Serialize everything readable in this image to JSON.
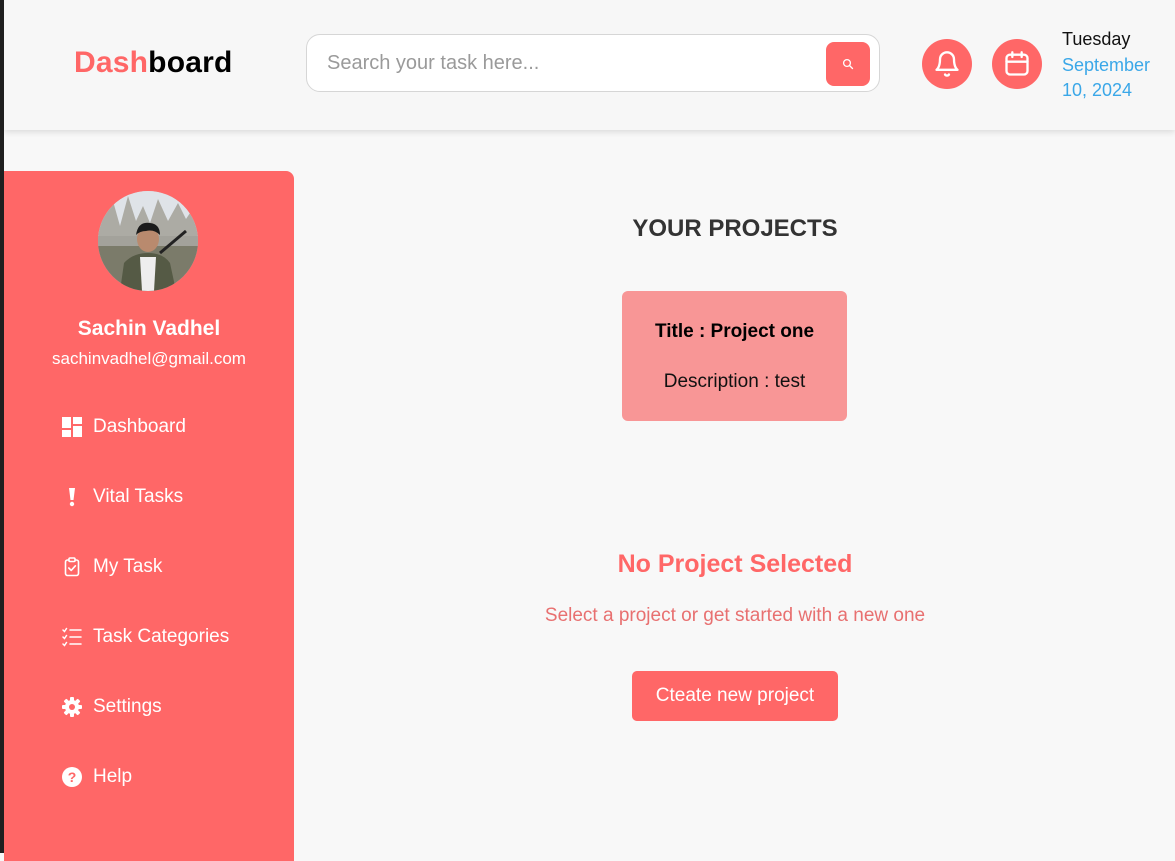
{
  "header": {
    "logo_part1": "Dash",
    "logo_part2": "board",
    "search_placeholder": "Search your task here...",
    "search_icon": "search-icon",
    "notification_icon": "bell-icon",
    "calendar_icon": "calendar-icon",
    "day": "Tuesday",
    "date": "September 10, 2024"
  },
  "user": {
    "name": "Sachin Vadhel",
    "email": "sachinvadhel@gmail.com"
  },
  "sidebar": {
    "items": [
      {
        "label": "Dashboard",
        "icon": "dashboard-icon"
      },
      {
        "label": "Vital Tasks",
        "icon": "exclamation-icon"
      },
      {
        "label": "My Task",
        "icon": "clipboard-check-icon"
      },
      {
        "label": "Task Categories",
        "icon": "list-icon"
      },
      {
        "label": "Settings",
        "icon": "gear-icon"
      },
      {
        "label": "Help",
        "icon": "help-icon"
      }
    ]
  },
  "main": {
    "title": "YOUR PROJECTS",
    "projects": [
      {
        "title": "Title : Project one",
        "description": "Description : test"
      }
    ],
    "empty_title": "No Project Selected",
    "empty_subtitle": "Select a project or get started with a new one",
    "new_button": "Cteate new project"
  },
  "colors": {
    "accent": "#ff6767",
    "card": "#f89696",
    "date": "#3aa7e8"
  }
}
